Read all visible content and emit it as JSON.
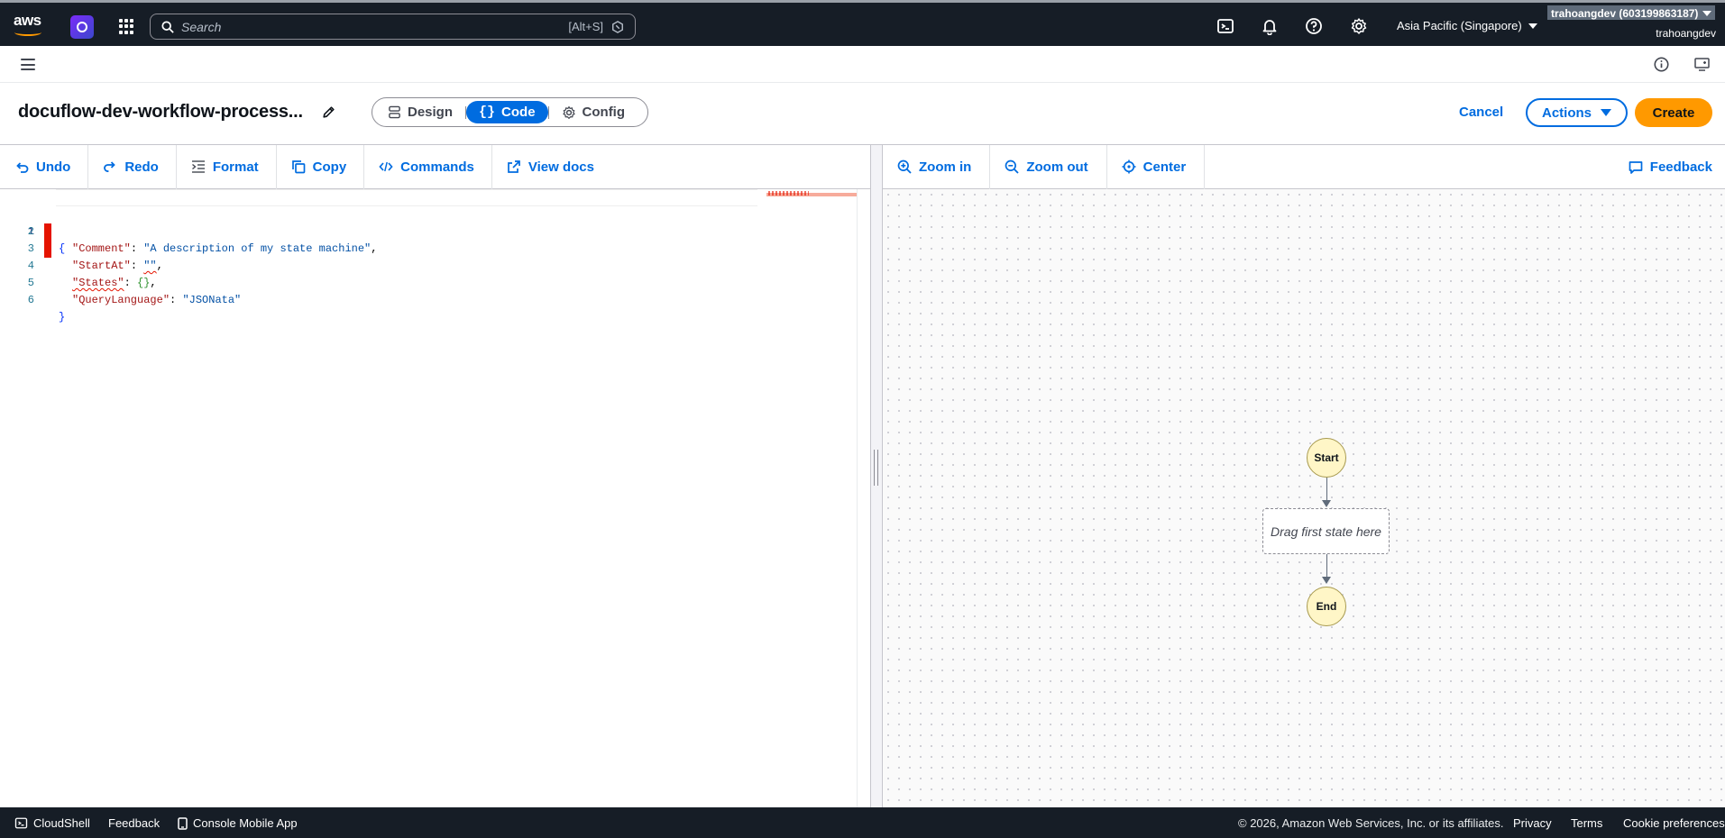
{
  "topnav": {
    "logo_text": "aws",
    "search_placeholder": "Search",
    "search_shortcut": "[Alt+S]",
    "region": "Asia Pacific (Singapore)",
    "account": "trahoangdev (603199863187)",
    "username": "trahoangdev"
  },
  "header": {
    "title": "docuflow-dev-workflow-process...",
    "modes": [
      {
        "label": "Design",
        "active": false
      },
      {
        "label": "Code",
        "active": true
      },
      {
        "label": "Config",
        "active": false
      }
    ],
    "cancel_label": "Cancel",
    "actions_label": "Actions",
    "create_label": "Create"
  },
  "code_toolbar": {
    "undo": "Undo",
    "redo": "Redo",
    "format": "Format",
    "copy": "Copy",
    "commands": "Commands",
    "view_docs": "View docs"
  },
  "editor": {
    "line_numbers": [
      "1",
      "2",
      "3",
      "4",
      "5",
      "6"
    ],
    "lines": {
      "l1": "{",
      "l2_key": "\"Comment\"",
      "l2_val": "\"A description of my state machine\"",
      "l3_key": "\"StartAt\"",
      "l3_val": "\"\"",
      "l4_key": "\"States\"",
      "l4_val": "{}",
      "l5_key": "\"QueryLanguage\"",
      "l5_val": "\"JSONata\"",
      "l6": "}",
      "colon": ": ",
      "comma": ","
    }
  },
  "graph_toolbar": {
    "zoom_in": "Zoom in",
    "zoom_out": "Zoom out",
    "center": "Center",
    "feedback": "Feedback"
  },
  "graph": {
    "start_label": "Start",
    "placeholder": "Drag first state here",
    "end_label": "End"
  },
  "footer": {
    "cloudshell": "CloudShell",
    "feedback": "Feedback",
    "mobile_app": "Console Mobile App",
    "copyright": "© 2026, Amazon Web Services, Inc. or its affiliates.",
    "privacy": "Privacy",
    "terms": "Terms",
    "cookies": "Cookie preferences"
  },
  "colors": {
    "nav_bg": "#161d26",
    "accent_blue": "#006ce0",
    "create_orange": "#ff9900",
    "error_red": "#e51400",
    "node_fill": "#fff6c7"
  }
}
